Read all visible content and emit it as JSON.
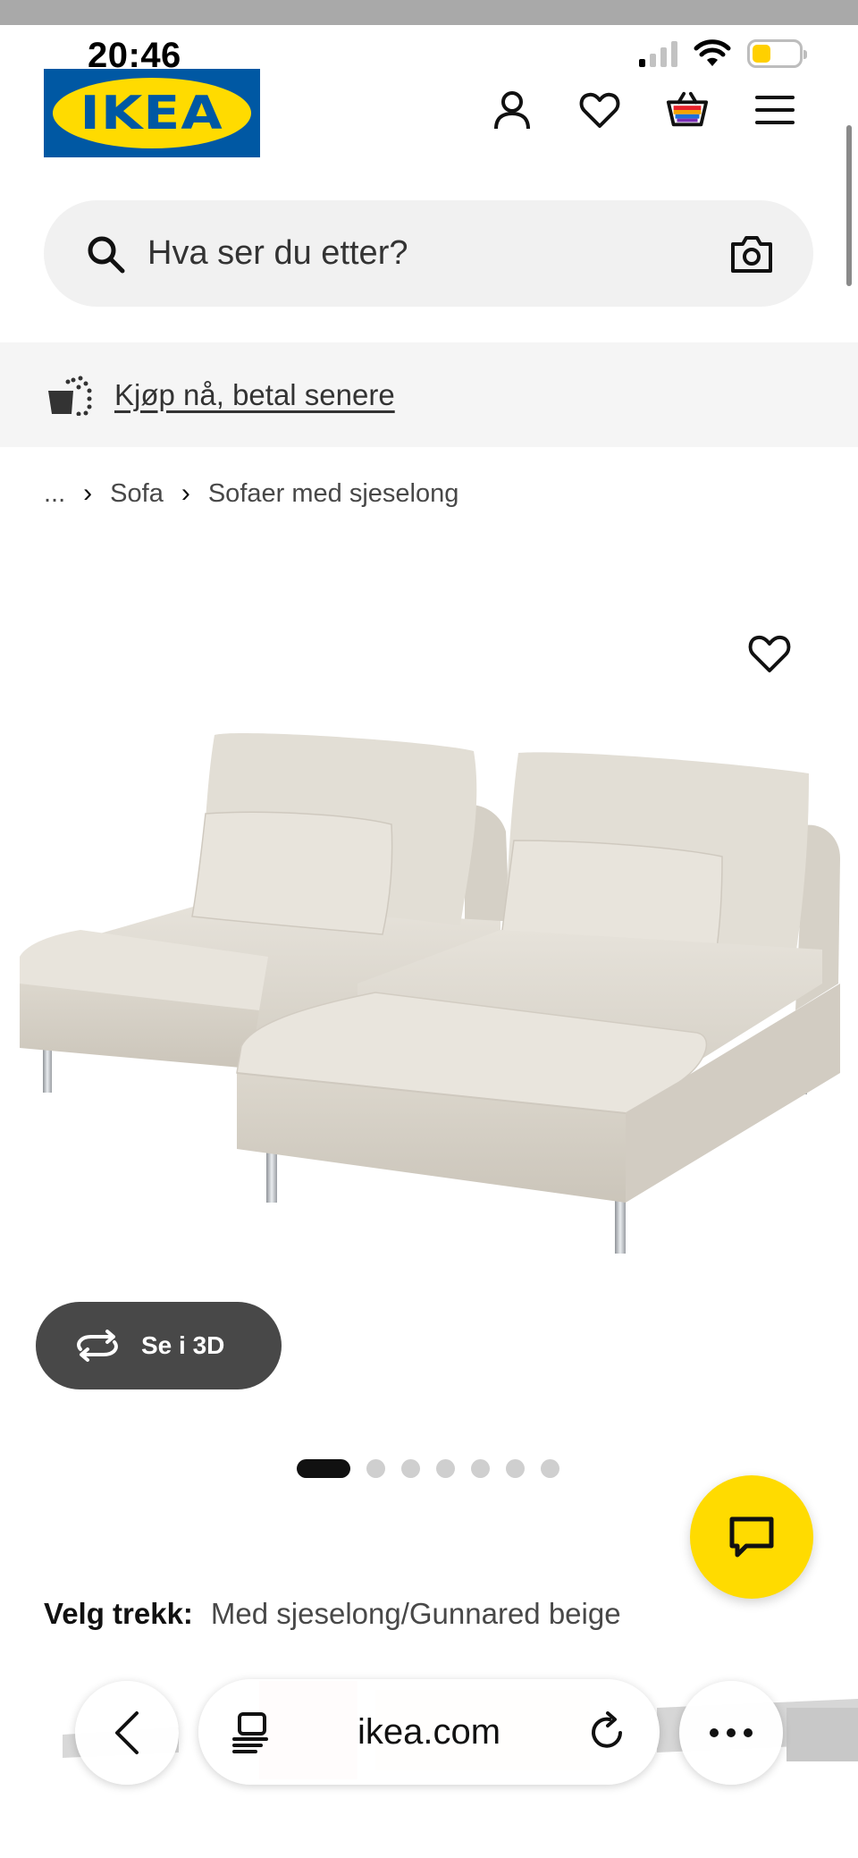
{
  "status_bar": {
    "time": "20:46"
  },
  "header": {
    "logo_text": "IKEA",
    "icons": [
      "account-icon",
      "wishlist-icon",
      "cart-icon",
      "menu-icon"
    ]
  },
  "search": {
    "placeholder": "Hva ser du etter?"
  },
  "promo": {
    "link_text": "Kjøp nå, betal senere"
  },
  "breadcrumb": {
    "ellipsis": "...",
    "items": [
      "Sofa",
      "Sofaer med sjeselong"
    ]
  },
  "product": {
    "view_3d_label": "Se i 3D",
    "image_count": 7,
    "active_image": 1,
    "variant_label": "Velg trekk:",
    "variant_value": "Med sjeselong/Gunnared beige"
  },
  "browser": {
    "url": "ikea.com"
  },
  "colors": {
    "ikea_blue": "#0058a3",
    "ikea_yellow": "#ffdb00",
    "button_dark": "#484848",
    "fabric_beige": "#dfdbd2"
  }
}
